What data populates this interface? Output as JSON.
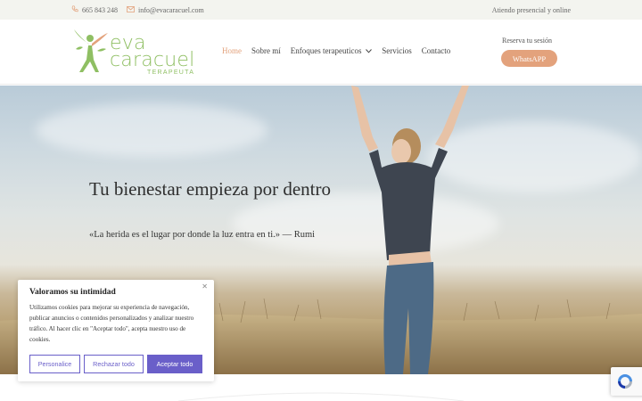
{
  "topbar": {
    "phone": "665 843 248",
    "email": "info@evacaracuel.com",
    "right_text": "Atiendo presencial y online"
  },
  "logo": {
    "name_line1": "eva",
    "name_line2": "caracuel",
    "subtitle": "TERAPEUTA"
  },
  "nav": {
    "items": [
      "Home",
      "Sobre mí",
      "Enfoques terapeuticos",
      "Servicios",
      "Contacto"
    ],
    "active": "Home"
  },
  "header": {
    "reserve": "Reserva tu sesión",
    "whatsapp": "WhatsAPP"
  },
  "hero": {
    "title": "Tu bienestar empieza por dentro",
    "quote": "«La herida es el lugar por donde la luz entra en ti.» — Rumi"
  },
  "cookie": {
    "title": "Valoramos su intimidad",
    "text": "Utilizamos cookies para mejorar su experiencia de navegación, publicar anuncios o contenidos personalizados y analizar nuestro tráfico. Al hacer clic en \"Aceptar todo\", acepta nuestro uso de cookies.",
    "btn_customize": "Personalice",
    "btn_reject": "Rechazar todo",
    "btn_accept": "Aceptar todo"
  },
  "colors": {
    "accent": "#e3a27c",
    "logo_green": "#8fbf63",
    "cookie_purple": "#6a5fc9"
  },
  "icons": [
    "phone-icon",
    "mail-icon",
    "chevron-down-icon",
    "close-icon",
    "recaptcha-icon"
  ]
}
